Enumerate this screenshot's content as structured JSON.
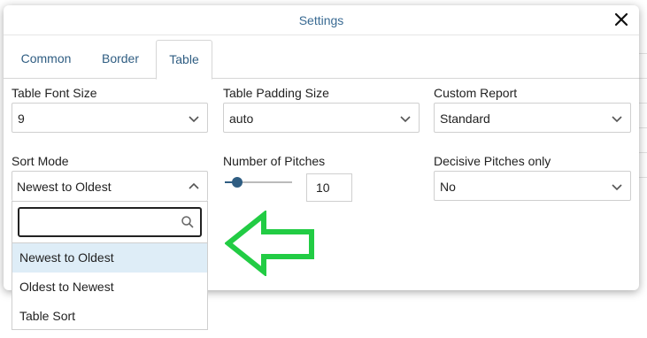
{
  "modal": {
    "title": "Settings"
  },
  "tabs": [
    {
      "label": "Common"
    },
    {
      "label": "Border"
    },
    {
      "label": "Table"
    }
  ],
  "active_tab": "Table",
  "fields": {
    "table_font_size": {
      "label": "Table Font Size",
      "value": "9"
    },
    "table_padding_size": {
      "label": "Table Padding Size",
      "value": "auto"
    },
    "custom_report": {
      "label": "Custom Report",
      "value": "Standard"
    },
    "sort_mode": {
      "label": "Sort Mode",
      "value": "Newest to Oldest"
    },
    "number_of_pitches": {
      "label": "Number of Pitches",
      "value": "10",
      "slider_fraction": 0.2
    },
    "decisive_pitches_only": {
      "label": "Decisive Pitches only",
      "value": "No"
    }
  },
  "sort_dropdown": {
    "search_placeholder": "",
    "options": [
      {
        "label": "Newest to Oldest",
        "selected": true
      },
      {
        "label": "Oldest to Newest",
        "selected": false
      },
      {
        "label": "Table Sort",
        "selected": false
      }
    ]
  },
  "colors": {
    "title": "#3a6b93",
    "tab_text": "#2f5d82",
    "selected_option_bg": "#deedf7",
    "arrow": "#22cc44"
  },
  "icons": {
    "close": "close-icon",
    "chevron": "chevron-down-icon",
    "chevron_up": "chevron-up-icon",
    "search": "search-icon",
    "arrow": "arrow-left-icon"
  }
}
